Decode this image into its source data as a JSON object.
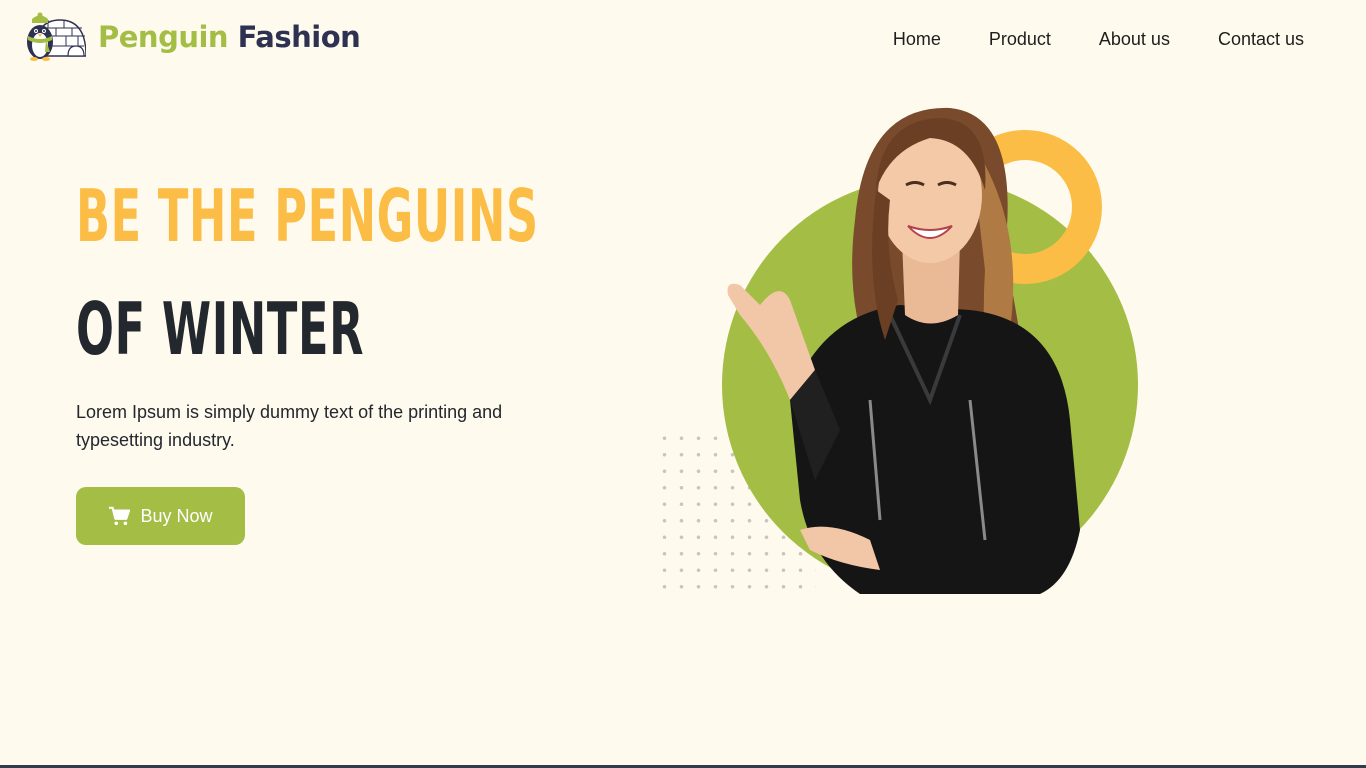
{
  "header": {
    "brand": {
      "word1": "Penguin",
      "word2": "Fashion"
    },
    "nav": [
      {
        "label": "Home"
      },
      {
        "label": "Product"
      },
      {
        "label": "About us"
      },
      {
        "label": "Contact us"
      }
    ]
  },
  "hero": {
    "headline_line1": "BE THE PENGUINS",
    "headline_line2": "OF WINTER",
    "lead": "Lorem Ipsum is simply dummy text of the printing and typesetting industry.",
    "buy_label": "Buy Now",
    "buy_icon": "cart-icon",
    "image_icon": "model-woman-leather-jacket"
  },
  "colors": {
    "background": "#fffaee",
    "accent_green": "#a3bd45",
    "accent_yellow": "#fbbd45",
    "brand_dark": "#2e3250",
    "text_dark": "#23272e"
  }
}
